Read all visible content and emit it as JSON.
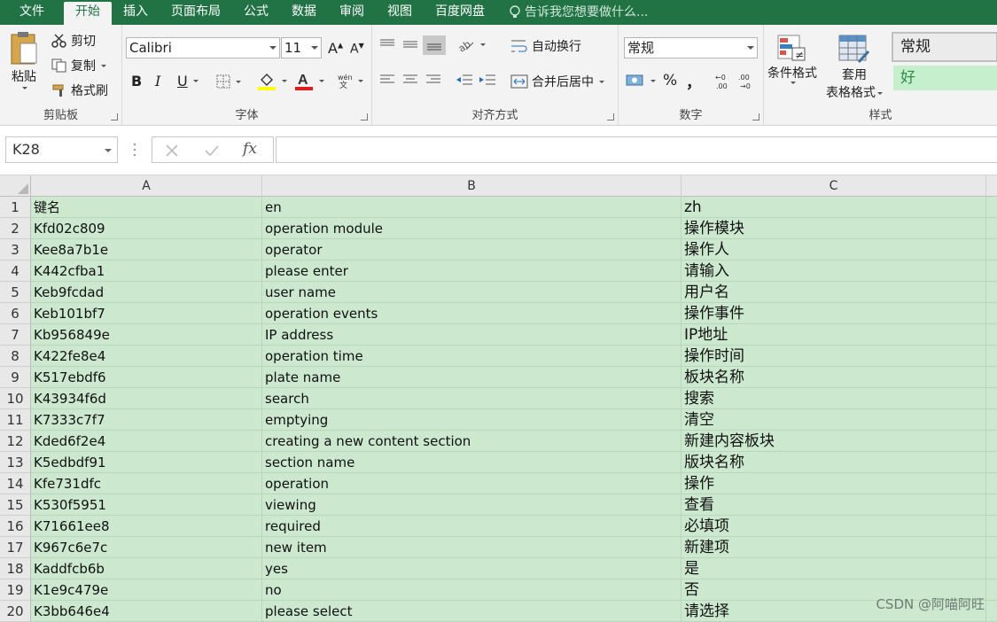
{
  "tabs": [
    "文件",
    "开始",
    "插入",
    "页面布局",
    "公式",
    "数据",
    "审阅",
    "视图",
    "百度网盘"
  ],
  "tell_me": "告诉我您想要做什么...",
  "clipboard": {
    "paste": "粘贴",
    "cut": "剪切",
    "copy": "复制",
    "format_painter": "格式刷",
    "label": "剪贴板"
  },
  "font": {
    "name": "Calibri",
    "size": "11",
    "label": "字体",
    "bold": "B",
    "italic": "I",
    "underline": "U"
  },
  "alignment": {
    "wrap": "自动换行",
    "merge": "合并后居中",
    "label": "对齐方式"
  },
  "number": {
    "format": "常规",
    "percent": "%",
    "comma": "，",
    "label": "数字"
  },
  "styles": {
    "conditional": "条件格式",
    "table_line1": "套用",
    "table_line2": "表格格式",
    "style_normal": "常规",
    "style_good": "好",
    "label": "样式"
  },
  "formula_bar": {
    "name_box": "K28",
    "fx": "fx",
    "value": ""
  },
  "columns": [
    "A",
    "B",
    "C"
  ],
  "rows": [
    {
      "n": "1",
      "a": "键名",
      "b": "en",
      "c": "zh"
    },
    {
      "n": "2",
      "a": "Kfd02c809",
      "b": "operation module",
      "c": "操作模块"
    },
    {
      "n": "3",
      "a": "Kee8a7b1e",
      "b": "operator",
      "c": "操作人"
    },
    {
      "n": "4",
      "a": "K442cfba1",
      "b": "please enter",
      "c": "请输入"
    },
    {
      "n": "5",
      "a": "Keb9fcdad",
      "b": "user name",
      "c": "用户名"
    },
    {
      "n": "6",
      "a": "Keb101bf7",
      "b": "operation events",
      "c": "操作事件"
    },
    {
      "n": "7",
      "a": "Kb956849e",
      "b": "IP address",
      "c": "IP地址"
    },
    {
      "n": "8",
      "a": "K422fe8e4",
      "b": "operation time",
      "c": "操作时间"
    },
    {
      "n": "9",
      "a": "K517ebdf6",
      "b": "plate name",
      "c": "板块名称"
    },
    {
      "n": "10",
      "a": "K43934f6d",
      "b": "search",
      "c": "搜索"
    },
    {
      "n": "11",
      "a": "K7333c7f7",
      "b": "emptying",
      "c": "清空"
    },
    {
      "n": "12",
      "a": "Kded6f2e4",
      "b": "creating a new content section",
      "c": "新建内容板块"
    },
    {
      "n": "13",
      "a": "K5edbdf91",
      "b": "section name",
      "c": "版块名称"
    },
    {
      "n": "14",
      "a": "Kfe731dfc",
      "b": "operation",
      "c": "操作"
    },
    {
      "n": "15",
      "a": "K530f5951",
      "b": "viewing",
      "c": "查看"
    },
    {
      "n": "16",
      "a": "K71661ee8",
      "b": "required",
      "c": "必填项"
    },
    {
      "n": "17",
      "a": "K967c6e7c",
      "b": "new item",
      "c": "新建项"
    },
    {
      "n": "18",
      "a": "Kaddfcb6b",
      "b": "yes",
      "c": "是"
    },
    {
      "n": "19",
      "a": "K1e9c479e",
      "b": "no",
      "c": "否"
    },
    {
      "n": "20",
      "a": "K3bb646e4",
      "b": "please select",
      "c": "请选择"
    }
  ],
  "watermark": "CSDN @阿喵阿旺",
  "colors": {
    "accent": "#217346",
    "cell_fill": "#cce8cf"
  }
}
